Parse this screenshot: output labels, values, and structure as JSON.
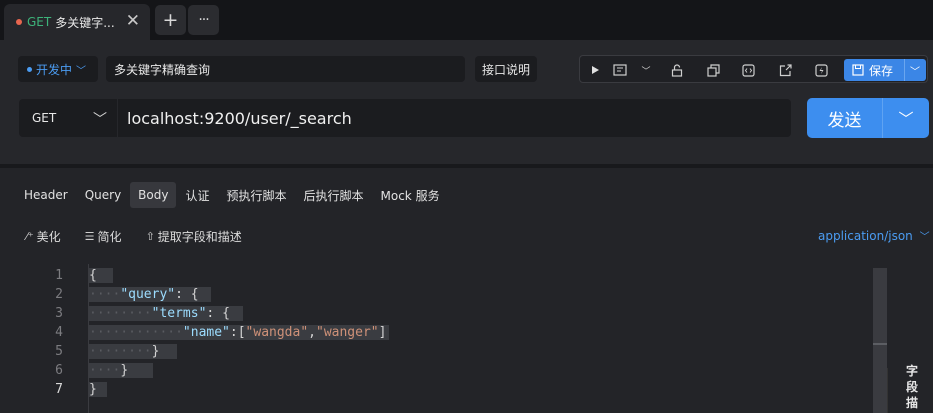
{
  "tabbar": {
    "tab": {
      "method": "GET",
      "title": "多关键字...",
      "close": "✕"
    },
    "add_label": "+",
    "more_label": "···"
  },
  "request": {
    "environment": "开发中",
    "name": "多关键字精确查询",
    "doc_button": "接口说明",
    "save_label": "保存",
    "method": "GET",
    "url": "localhost:9200/user/_search",
    "send_label": "发送"
  },
  "tabs": [
    "Header",
    "Query",
    "Body",
    "认证",
    "预执行脚本",
    "后执行脚本",
    "Mock 服务"
  ],
  "active_tab": "Body",
  "body_tools": {
    "beautify": "美化",
    "simplify": "简化",
    "extract": "提取字段和描述"
  },
  "content_type": "application/json",
  "editor": {
    "current_line": 7,
    "lines": [
      {
        "num": "1",
        "indent": "",
        "text": "{"
      },
      {
        "num": "2",
        "indent": "····",
        "key": "\"query\"",
        "rest": ": {"
      },
      {
        "num": "3",
        "indent": "········",
        "key": "\"terms\"",
        "rest": ": {"
      },
      {
        "num": "4",
        "indent": "············",
        "key": "\"name\"",
        "rest": ":[",
        "strs": [
          "\"wangda\"",
          "\"wanger\""
        ],
        "tail": "]"
      },
      {
        "num": "5",
        "indent": "········",
        "text": "}"
      },
      {
        "num": "6",
        "indent": "····",
        "text": "}"
      },
      {
        "num": "7",
        "indent": "",
        "text": "}"
      }
    ]
  },
  "side_panel": {
    "chars": [
      "字",
      "段",
      "描"
    ]
  },
  "colors": {
    "accent": "#3d8eef",
    "get_method": "#3db37a",
    "json_key": "#9cdcfe",
    "json_string": "#ce9178"
  }
}
